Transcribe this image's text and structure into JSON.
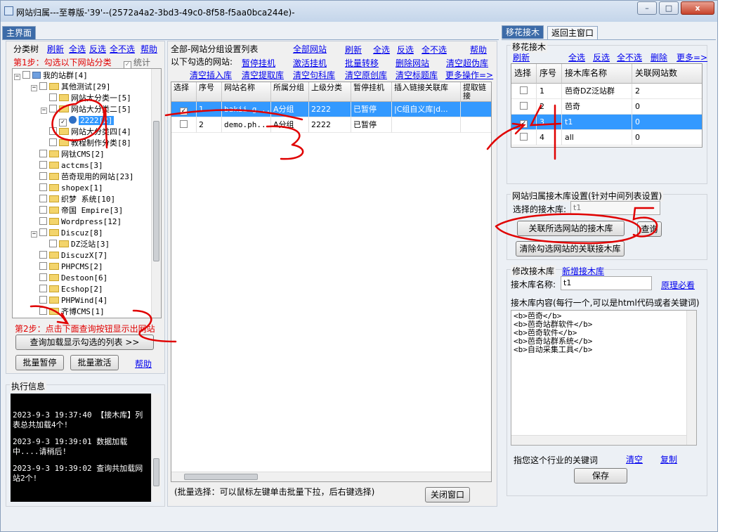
{
  "window": {
    "title": "网站归属---至尊版-'39'--(2572a4a2-3bd3-49c0-8f58-f5aa0bca244e)-",
    "minimize": "–",
    "maximize": "□",
    "close": "x"
  },
  "left_tab": "主界面",
  "right_tabs": [
    "移花接木",
    "返回主窗口"
  ],
  "left": {
    "toolbar": {
      "title": "分类树",
      "refresh": "刷新",
      "select_all": "全选",
      "invert": "反选",
      "select_none": "全不选",
      "help": "帮助"
    },
    "step1": "第1步：勾选以下网站分类",
    "stats": "统计",
    "tree": [
      {
        "label": "我的站群[4]"
      },
      {
        "label": "其他测试[29]"
      },
      {
        "label": "网站大分类一[5]"
      },
      {
        "label": "网站大分类二[5]"
      },
      {
        "label": "2222[2]"
      },
      {
        "label": "网站大分类四[4]"
      },
      {
        "label": "教程制作分类[8]"
      },
      {
        "label": "网钛CMS[2]"
      },
      {
        "label": "actcms[3]"
      },
      {
        "label": "芭奇现用的网站[23]"
      },
      {
        "label": "shopex[1]"
      },
      {
        "label": "织梦 系统[10]"
      },
      {
        "label": "帝国 Empire[3]"
      },
      {
        "label": "Wordpress[12]"
      },
      {
        "label": "Discuz[8]"
      },
      {
        "label": "DZ泛站[3]"
      },
      {
        "label": "DiscuzX[7]"
      },
      {
        "label": "PHPCMS[2]"
      },
      {
        "label": "Destoon[6]"
      },
      {
        "label": "Ecshop[2]"
      },
      {
        "label": "PHPWind[4]"
      },
      {
        "label": "齐博CMS[1]"
      }
    ],
    "step2": "第2步：点击下面查询按钮显示出网站",
    "query_btn": "查询加载显示勾选的列表 >>",
    "pause_btn": "批量暂停",
    "activate_btn": "批量激活",
    "help": "帮助",
    "log_title": "执行信息",
    "log": [
      "2023-9-3 19:37:40 【接木库】列表总共加载4个!",
      "2023-9-3 19:39:01 数据加载中....请稍后!",
      "2023-9-3 19:39:02 查询共加载网站2个!"
    ]
  },
  "middle": {
    "title": "全部-网站分组设置列表",
    "links_top": {
      "all_sites": "全部网站",
      "refresh": "刷新",
      "select_all": "全选",
      "invert": "反选",
      "select_none": "全不选",
      "help": "帮助"
    },
    "row1_label": "以下勾选的网站:",
    "row1": [
      "暂停挂机",
      "激活挂机",
      "批量转移",
      "删除网站",
      "清空超伪库"
    ],
    "row2": [
      "清空插入库",
      "清空提取库",
      "清空句科库",
      "清空原创库",
      "清空标题库",
      "更多操作=>"
    ],
    "columns": [
      "选择",
      "序号",
      "网站名称",
      "所属分组",
      "上级分类",
      "暂停挂机",
      "插入链接关联库",
      "提取链接"
    ],
    "rows": [
      {
        "checked": "✓",
        "no": "1",
        "name": "bakii.g...",
        "group": "A分组",
        "parent": "2222",
        "status": "已暂停",
        "link_lib": "|C组自义库|d...",
        "extract": ""
      },
      {
        "checked": "",
        "no": "2",
        "name": "demo.ph...",
        "group": "A分组",
        "parent": "2222",
        "status": "已暂停",
        "link_lib": "",
        "extract": ""
      }
    ],
    "hint": "(批量选择：可以鼠标左键单击批量下拉，后右键选择)",
    "close_btn": "关闭窗口"
  },
  "right": {
    "section_title": "移花接木",
    "toolbar": {
      "refresh": "刷新",
      "select_all": "全选",
      "invert": "反选",
      "select_none": "全不选",
      "delete": "删除",
      "more": "更多=>"
    },
    "columns": [
      "选择",
      "序号",
      "接木库名称",
      "关联网站数"
    ],
    "rows": [
      {
        "checked": "",
        "no": "1",
        "name": "芭奇DZ泛站群",
        "count": "2"
      },
      {
        "checked": "",
        "no": "2",
        "name": "芭奇",
        "count": "0"
      },
      {
        "checked": "✓",
        "no": "3",
        "name": "t1",
        "count": "0"
      },
      {
        "checked": "",
        "no": "4",
        "name": "all",
        "count": "0"
      }
    ],
    "selected_row": 2,
    "assign": {
      "title": "网站归属接木库设置(针对中间列表设置)",
      "lib_label": "选择的接木库:",
      "lib_value": "t1",
      "link_btn": "关联所选网站的接木库",
      "query_btn": "查询",
      "clear_btn": "清除勾选网站的关联接木库"
    },
    "edit": {
      "title": "修改接木库",
      "new_link": "新增接木库",
      "name_label": "接木库名称:",
      "name_value": "t1",
      "principle": "原理必看",
      "content_label": "接木库内容(每行一个,可以是html代码或者关键词)",
      "content": "<b>芭奇</b>\n<b>芭奇站群软件</b>\n<b>芭奇软件</b>\n<b>芭奇站群系统</b>\n<b>自动采集工具</b>",
      "hint": "指您这个行业的关键词",
      "clear": "清空",
      "copy": "复制",
      "save_btn": "保存"
    }
  },
  "colors": {
    "selection": "#3399ff",
    "link": "#0000ee",
    "step": "#e00000",
    "active_tab": "#3c6ba8",
    "annotation": "#e00000"
  },
  "annotations": [
    "1",
    "3",
    "4",
    "5"
  ]
}
